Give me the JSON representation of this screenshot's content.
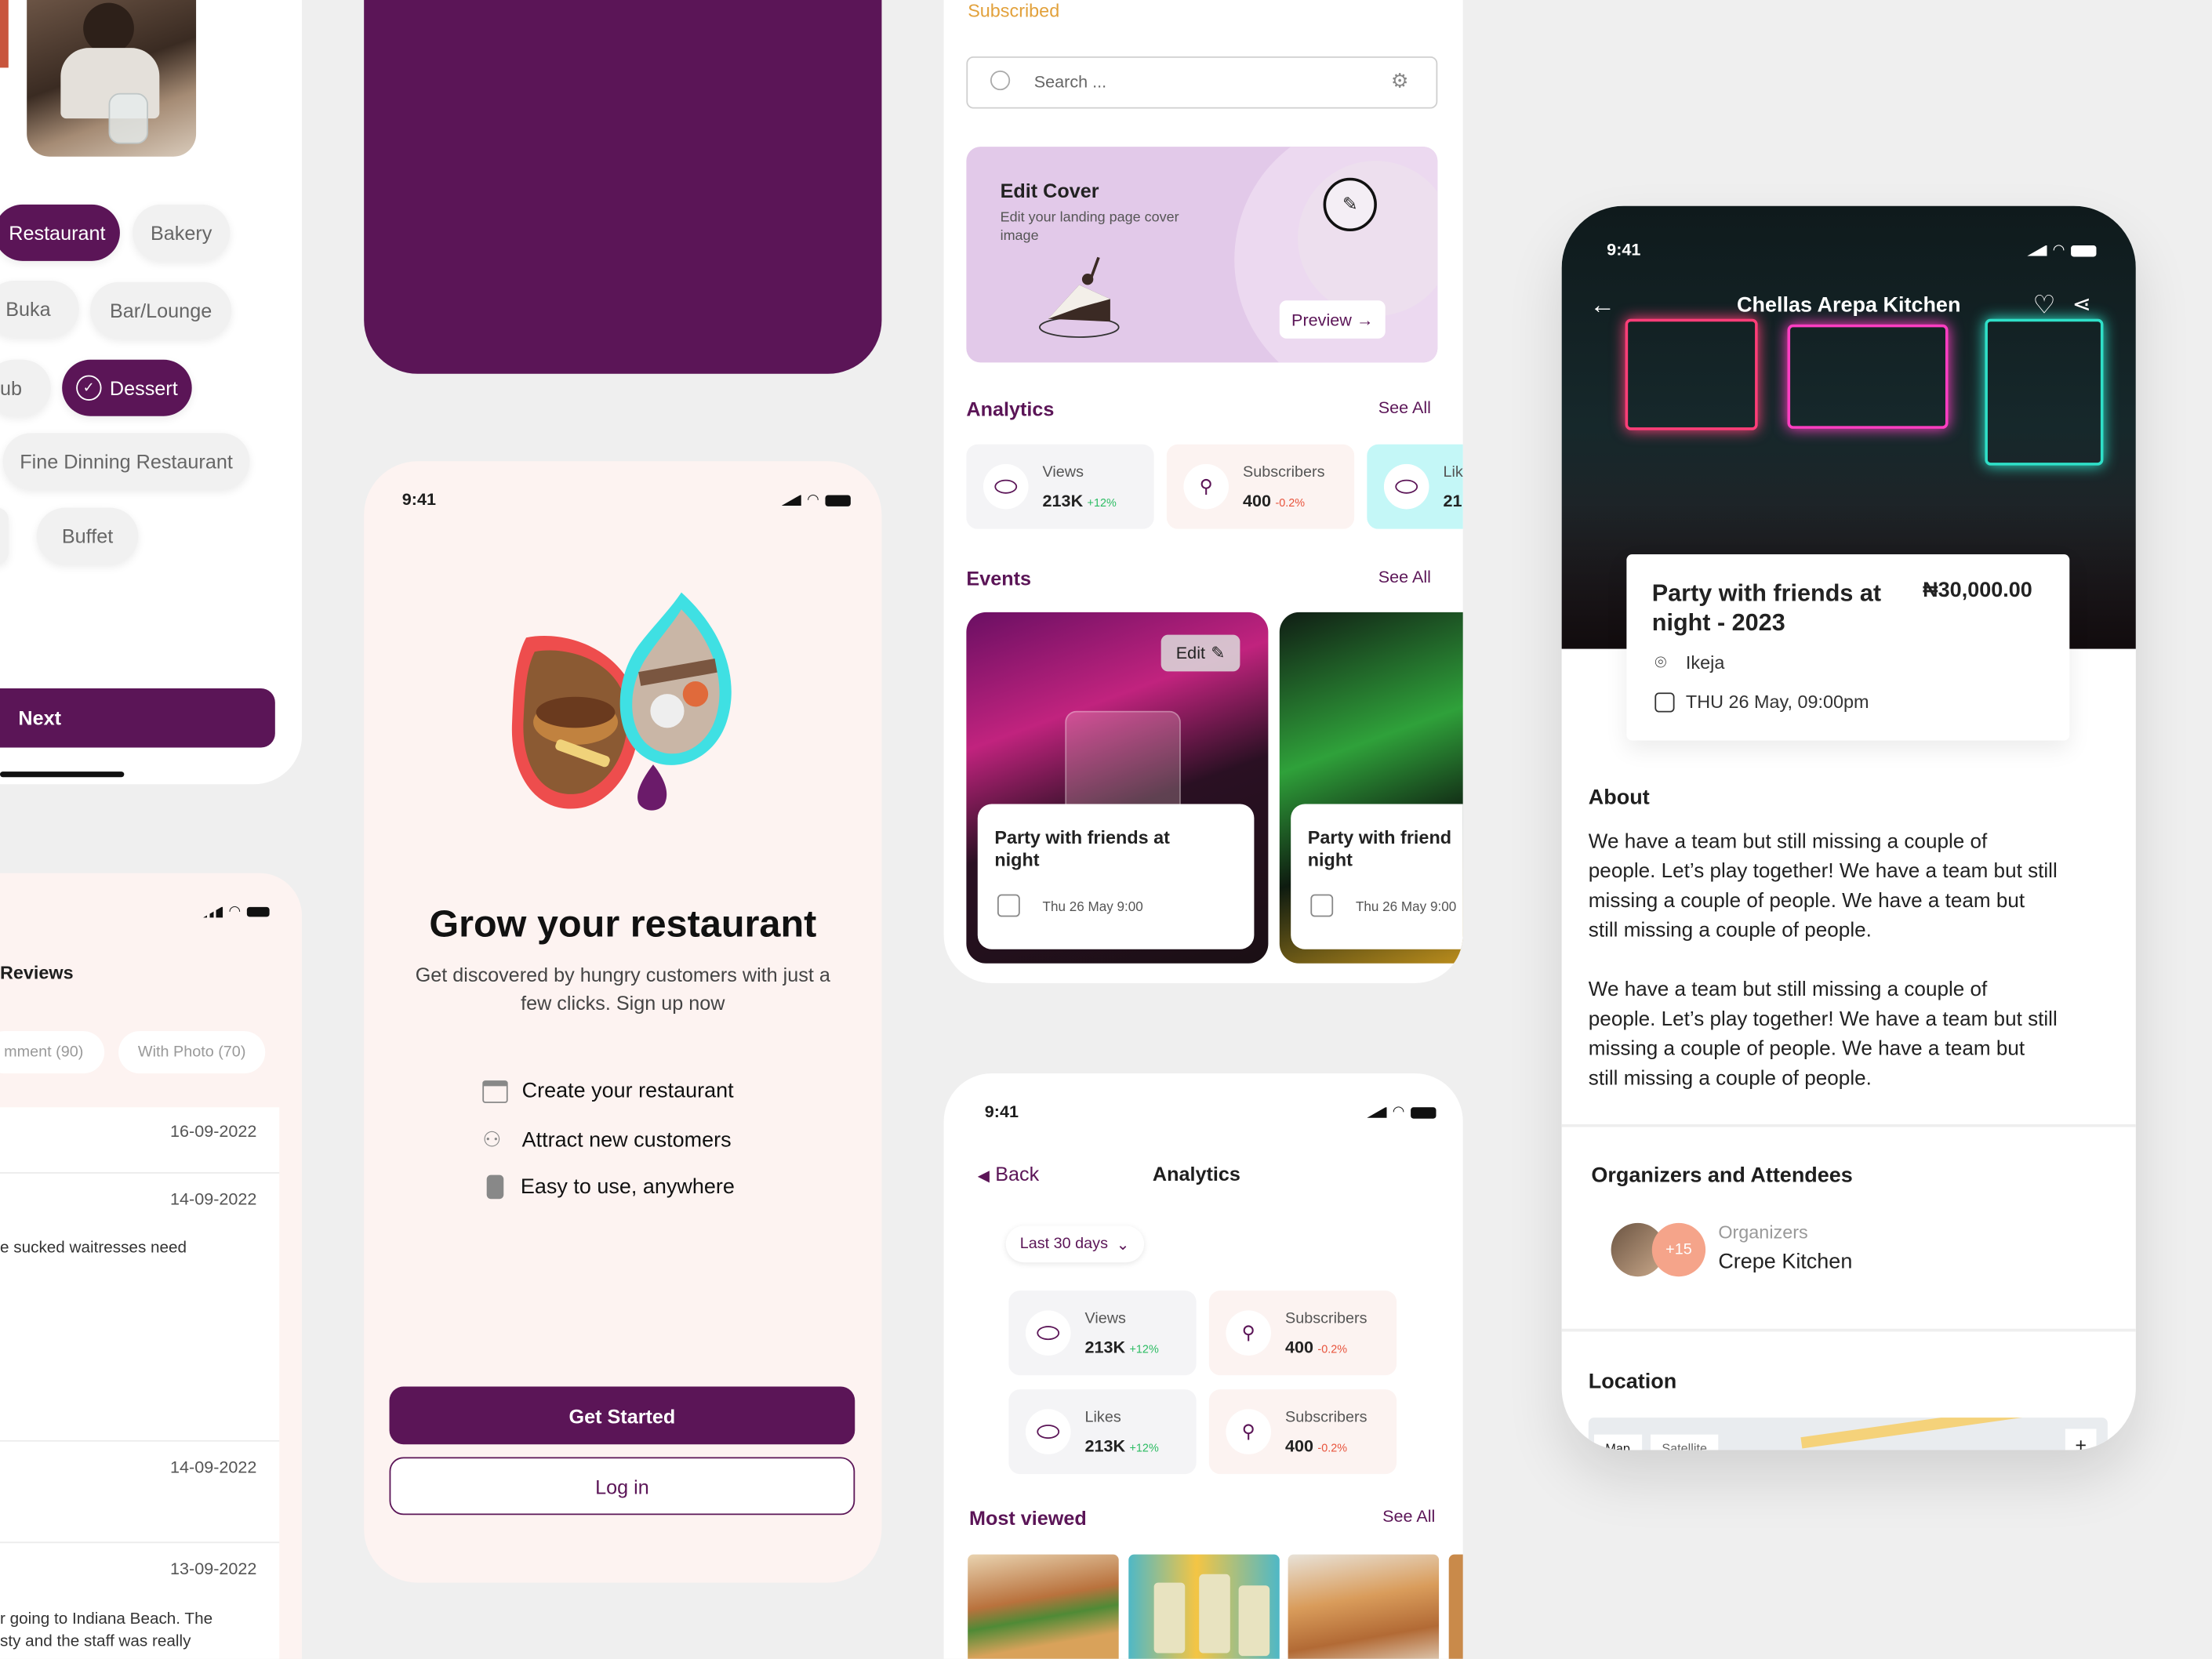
{
  "status_time": "9:41",
  "filters": {
    "chips": [
      {
        "label": "Restaurant",
        "selected": true
      },
      {
        "label": "Bakery",
        "selected": false
      },
      {
        "label": "Buka",
        "selected": false
      },
      {
        "label": "Bar/Lounge",
        "selected": false
      },
      {
        "label": "ub",
        "selected": false
      },
      {
        "label": "Dessert",
        "selected": true
      },
      {
        "label": "Fine Dinning Restaurant",
        "selected": false
      },
      {
        "label": "Buffet",
        "selected": false
      }
    ],
    "next_label": "Next"
  },
  "reviews": {
    "title": "Reviews",
    "tabs": [
      "mment (90)",
      "With Photo (70)"
    ],
    "dates": [
      "16-09-2022",
      "14-09-2022",
      "14-09-2022",
      "13-09-2022"
    ],
    "snippet_1": "e sucked waitresses need",
    "snippet_2_line1": "r going to Indiana Beach. The",
    "snippet_2_line2": "sty and the staff was really"
  },
  "onboarding": {
    "title": "Grow your restaurant",
    "subtitle_line1": "Get discovered by hungry customers with just a",
    "subtitle_line2": "few clicks. Sign up now",
    "features": [
      {
        "icon": "store-icon",
        "label": "Create your restaurant"
      },
      {
        "icon": "users-icon",
        "label": "Attract new customers"
      },
      {
        "icon": "phone-icon",
        "label": "Easy to use, anywhere"
      }
    ],
    "primary_label": "Get Started",
    "secondary_label": "Log in"
  },
  "dashboard": {
    "top_label": "Subscribed",
    "search_placeholder": "Search ...",
    "cover": {
      "title": "Edit Cover",
      "desc_line1": "Edit your landing page cover",
      "desc_line2": "image",
      "preview_label": "Preview →"
    },
    "analytics_title": "Analytics",
    "see_all": "See All",
    "stats": [
      {
        "label": "Views",
        "value": "213K",
        "delta": "+12%",
        "trend": "up"
      },
      {
        "label": "Subscribers",
        "value": "400",
        "delta": "-0.2%",
        "trend": "down"
      },
      {
        "label": "Lik",
        "value": "21:",
        "delta": "",
        "trend": "up"
      }
    ],
    "events_title": "Events",
    "events": [
      {
        "title_line1": "Party with friends at",
        "title_line2": "night",
        "date": "Thu 26 May 9:00",
        "edit_label": "Edit"
      },
      {
        "title_line1": "Party with friend",
        "title_line2": "night",
        "date": "Thu 26 May 9:00"
      }
    ]
  },
  "analytics_screen": {
    "back_label": "Back",
    "title": "Analytics",
    "range_label": "Last 30 days",
    "stats": [
      {
        "label": "Views",
        "value": "213K",
        "delta": "+12%",
        "trend": "up"
      },
      {
        "label": "Subscribers",
        "value": "400",
        "delta": "-0.2%",
        "trend": "down"
      },
      {
        "label": "Likes",
        "value": "213K",
        "delta": "+12%",
        "trend": "up"
      },
      {
        "label": "Subscribers",
        "value": "400",
        "delta": "-0.2%",
        "trend": "down"
      }
    ],
    "most_viewed_title": "Most viewed",
    "see_all": "See All"
  },
  "event_detail": {
    "header_title": "Chellas Arepa Kitchen",
    "event_title_line1": "Party with friends at",
    "event_title_line2": "night - 2023",
    "price": "₦30,000.00",
    "location": "Ikeja",
    "datetime": "THU 26 May, 09:00pm",
    "about_title": "About",
    "about_p1": [
      "We have a team but still missing a couple of",
      "people. Let’s play together! We have a team but still",
      "missing a couple of people. We have a team but",
      "still missing a couple of people."
    ],
    "about_p2": [
      "We have a team but still missing a couple of",
      "people. Let’s play together! We have a team but still",
      "missing a couple of people. We have a team but",
      "still missing a couple of people."
    ],
    "organizers_title": "Organizers and Attendees",
    "attendee_badge": "+15",
    "organizer_role": "Organizers",
    "organizer_name": "Crepe Kitchen",
    "location_title": "Location",
    "map_labels": [
      "Map",
      "Satellite"
    ]
  },
  "colors": {
    "brand": "#5b1557",
    "accent_red": "#ee4d4d",
    "accent_cyan": "#3fe0e3",
    "cover_bg": "#e2c9e9",
    "positive": "#2cbc63",
    "negative": "#e8543d"
  }
}
